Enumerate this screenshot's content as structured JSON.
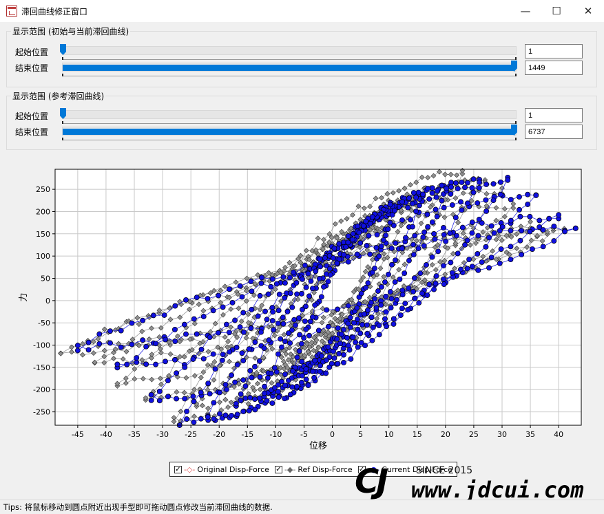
{
  "window": {
    "title": "滞回曲线修正窗口",
    "minimize_glyph": "—",
    "maximize_glyph": "☐",
    "close_glyph": "✕"
  },
  "group1": {
    "title": "显示范围 (初始与当前滞回曲线)",
    "start_label": "起始位置",
    "end_label": "结束位置",
    "start_value": "1",
    "end_value": "1449",
    "start_fraction": 0,
    "end_fraction": 1
  },
  "group2": {
    "title": "显示范围 (参考滞回曲线)",
    "start_label": "起始位置",
    "end_label": "结束位置",
    "start_value": "1",
    "end_value": "6737",
    "start_fraction": 0,
    "end_fraction": 1
  },
  "legend": {
    "items": [
      {
        "label": "Original Disp-Force",
        "checked": "✓",
        "color": "#e06060"
      },
      {
        "label": "Ref Disp-Force",
        "checked": "✓",
        "color": "#808080"
      },
      {
        "label": "Current Disp-Force",
        "checked": "✓",
        "color": "#0000e0"
      }
    ]
  },
  "status": {
    "tips": "Tips: 将鼠标移动到圆点附近出现手型即可拖动圆点修改当前滞回曲线的数据."
  },
  "watermark": {
    "logo": "CJ",
    "since": "SINCE 2015",
    "url": "www.jdcui.com"
  },
  "chart_data": {
    "type": "scatter",
    "xlabel": "位移",
    "ylabel": "力",
    "xlim": [
      -49,
      44
    ],
    "ylim": [
      -280,
      295
    ],
    "xticks": [
      -45,
      -40,
      -35,
      -30,
      -25,
      -20,
      -15,
      -10,
      -5,
      0,
      5,
      10,
      15,
      20,
      25,
      30,
      35,
      40
    ],
    "yticks": [
      -250,
      -200,
      -150,
      -100,
      -50,
      0,
      50,
      100,
      150,
      200,
      250
    ],
    "grid": true,
    "series": [
      {
        "name": "Ref Disp-Force",
        "color": "#909090",
        "marker": "diamond",
        "loops": [
          {
            "xmin": -48,
            "xmax": 41,
            "fmin": -118,
            "fmax": 162
          },
          {
            "xmin": -45,
            "xmax": 38,
            "fmin": -105,
            "fmax": 150
          },
          {
            "xmin": -42,
            "xmax": 35,
            "fmin": -140,
            "fmax": 170
          },
          {
            "xmin": -38,
            "xmax": 32,
            "fmin": -185,
            "fmax": 215
          },
          {
            "xmin": -33,
            "xmax": 30,
            "fmin": -220,
            "fmax": 245
          },
          {
            "xmin": -28,
            "xmax": 27,
            "fmin": -265,
            "fmax": 270
          },
          {
            "xmin": -24,
            "xmax": 23,
            "fmin": -240,
            "fmax": 290
          },
          {
            "xmin": -19,
            "xmax": 19,
            "fmin": -200,
            "fmax": 250
          },
          {
            "xmin": -14,
            "xmax": 14,
            "fmin": -170,
            "fmax": 210
          },
          {
            "xmin": -9,
            "xmax": 10,
            "fmin": -130,
            "fmax": 170
          }
        ]
      },
      {
        "name": "Current Disp-Force",
        "color": "#1010e0",
        "marker": "circle",
        "loops": [
          {
            "xmin": -45,
            "xmax": 43,
            "fmin": -105,
            "fmax": 162
          },
          {
            "xmin": -38,
            "xmax": 40,
            "fmin": -150,
            "fmax": 190
          },
          {
            "xmin": -32,
            "xmax": 36,
            "fmin": -220,
            "fmax": 240
          },
          {
            "xmin": -27,
            "xmax": 31,
            "fmin": -275,
            "fmax": 268
          },
          {
            "xmin": -22,
            "xmax": 26,
            "fmin": -260,
            "fmax": 272
          },
          {
            "xmin": -17,
            "xmax": 21,
            "fmin": -230,
            "fmax": 260
          },
          {
            "xmin": -12,
            "xmax": 16,
            "fmin": -200,
            "fmax": 230
          },
          {
            "xmin": -7,
            "xmax": 11,
            "fmin": -160,
            "fmax": 210
          }
        ]
      }
    ]
  }
}
